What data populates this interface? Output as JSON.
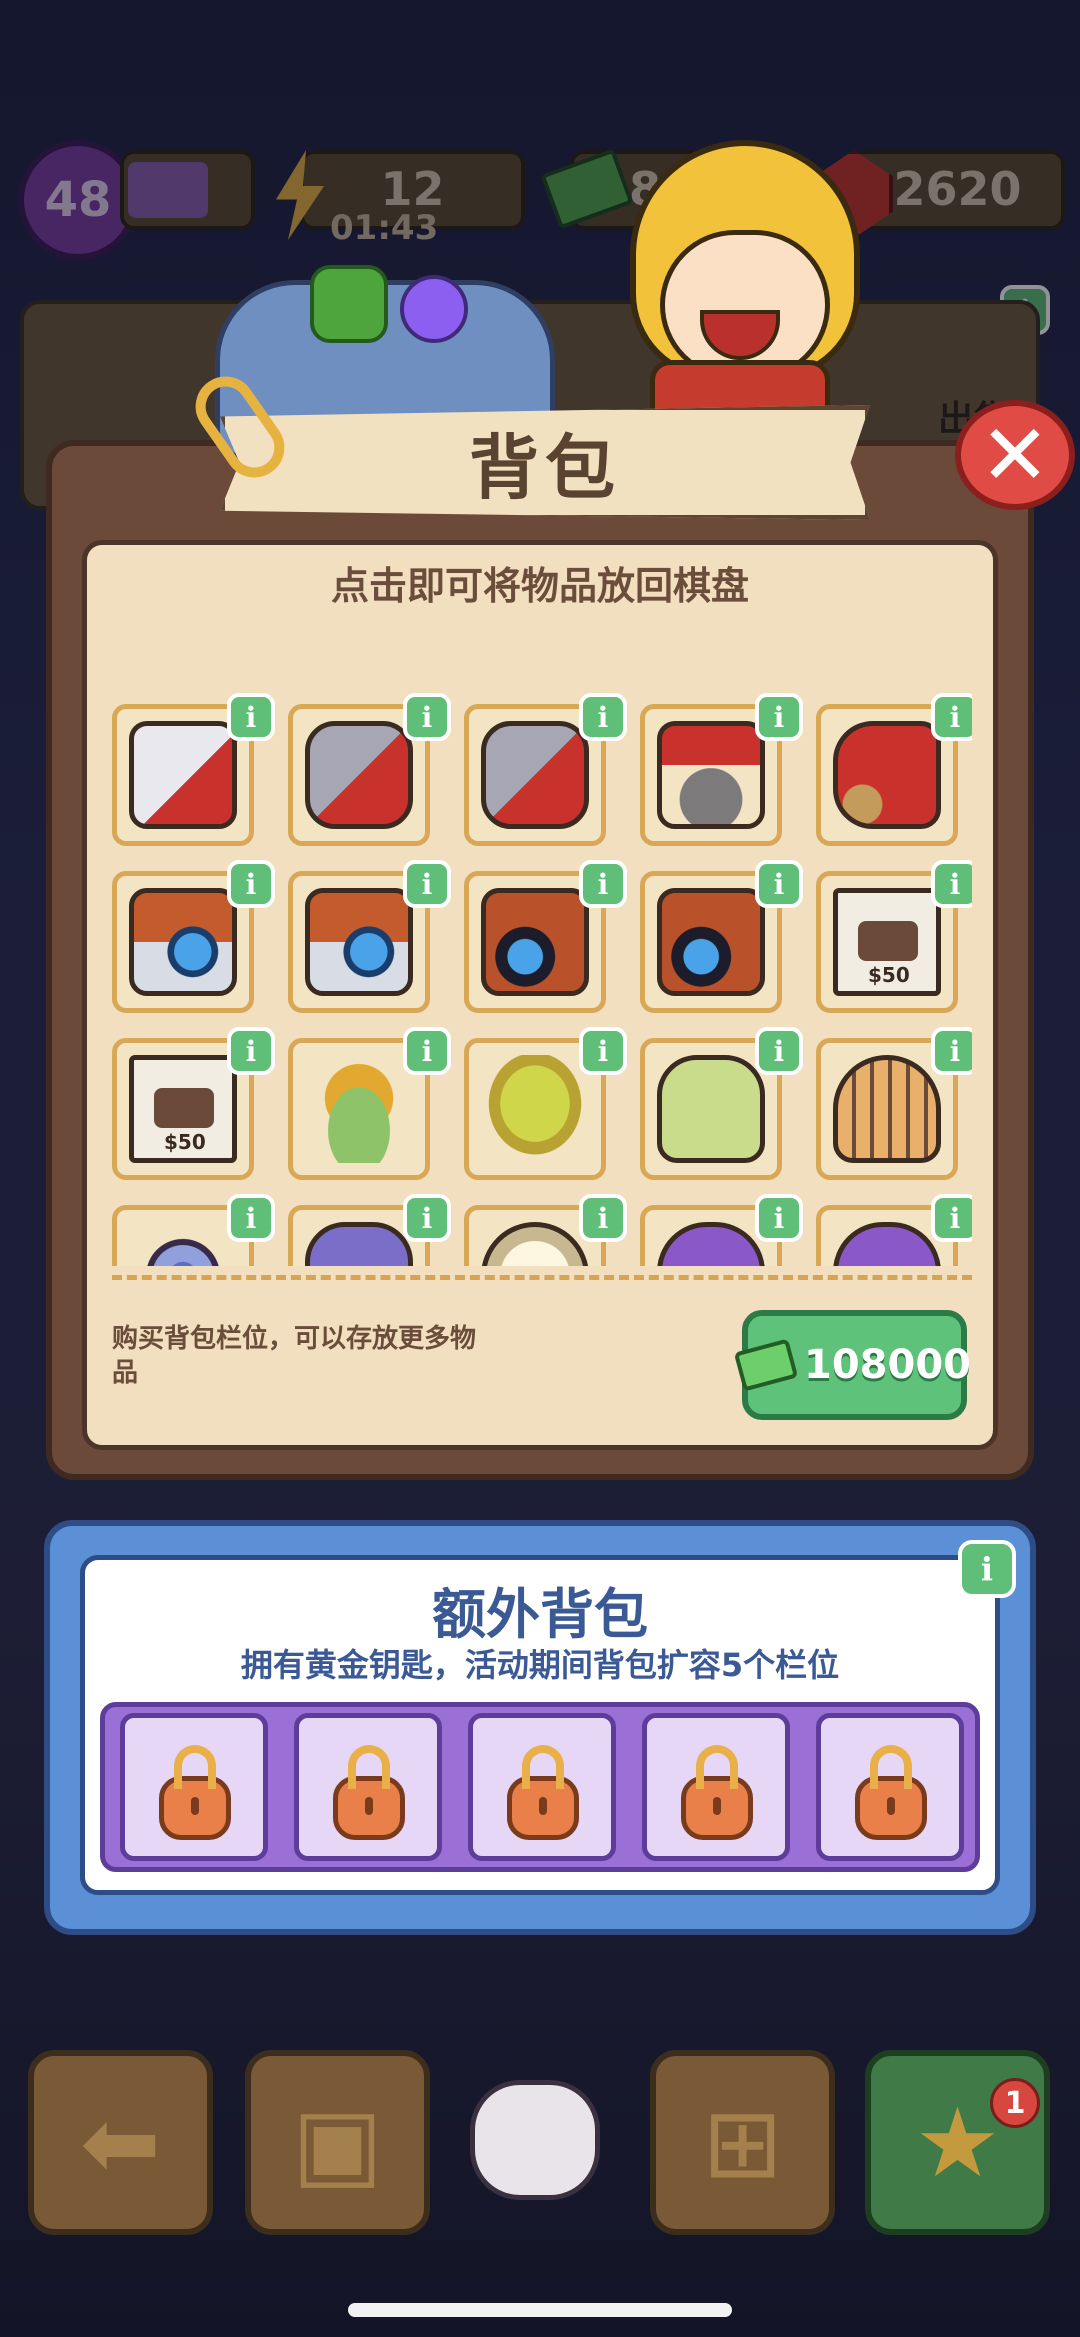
{
  "hud": {
    "level": "48",
    "energy": "12",
    "energy_timer": "01:43",
    "cash": "8",
    "gems": "2620"
  },
  "background": {
    "sell_label": "出售"
  },
  "backpack": {
    "title": "背包",
    "hint": "点击即可将物品放回棋盘",
    "info_glyph": "i",
    "close_glyph": "✕",
    "items": [
      {
        "name": "hand-saw",
        "cls": "it-saw"
      },
      {
        "name": "hacksaw",
        "cls": "it-hacksaw"
      },
      {
        "name": "hacksaw",
        "cls": "it-hacksaw"
      },
      {
        "name": "plunger",
        "cls": "it-plunger"
      },
      {
        "name": "cart",
        "cls": "it-cart"
      },
      {
        "name": "camera",
        "cls": "it-camera"
      },
      {
        "name": "camera",
        "cls": "it-camera"
      },
      {
        "name": "pro-camera",
        "cls": "it-camera2"
      },
      {
        "name": "pro-camera",
        "cls": "it-camera2"
      },
      {
        "name": "wanted-poster",
        "cls": "it-poster",
        "label": "$50"
      },
      {
        "name": "wanted-poster",
        "cls": "it-poster",
        "label": "$50"
      },
      {
        "name": "straw-hat",
        "cls": "it-hat"
      },
      {
        "name": "toilet",
        "cls": "it-toilet"
      },
      {
        "name": "lotion-bottle",
        "cls": "it-bottle"
      },
      {
        "name": "tiger-figure",
        "cls": "it-tiger"
      },
      {
        "name": "wheel",
        "cls": "it-wheel"
      },
      {
        "name": "bicycle",
        "cls": "it-bike"
      },
      {
        "name": "astronaut",
        "cls": "it-astro"
      },
      {
        "name": "bunny",
        "cls": "it-bunny"
      },
      {
        "name": "bunny",
        "cls": "it-bunny"
      }
    ],
    "buy_text": "购买背包栏位，可以存放更多物品",
    "buy_price": "108000"
  },
  "extra_backpack": {
    "title": "额外背包",
    "subtitle": "拥有黄金钥匙，活动期间背包扩容5个栏位",
    "locked_slots": 5
  },
  "toolbar": {
    "notification_count": "1"
  },
  "colors": {
    "accent_green": "#5fc27a",
    "close_red": "#e04b45",
    "panel_brown": "#6b4a3a",
    "extra_blue": "#5b8fd6",
    "lock_purple": "#9a6fd6"
  }
}
